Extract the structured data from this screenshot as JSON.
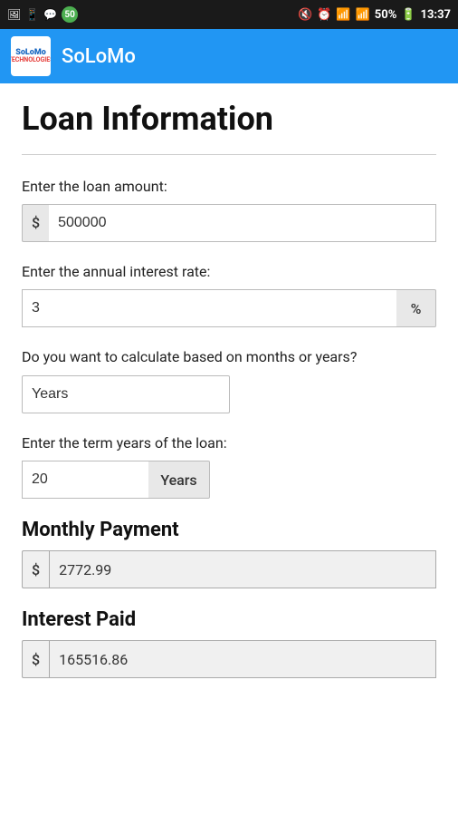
{
  "statusBar": {
    "time": "13:37",
    "battery": "50%",
    "notificationCount": "50"
  },
  "appBar": {
    "logo": "SoLoMo",
    "title": "SoLoMo"
  },
  "page": {
    "title": "Loan Information"
  },
  "form": {
    "loanAmountLabel": "Enter the loan amount:",
    "loanAmountPrefix": "$",
    "loanAmountValue": "500000",
    "interestRateLabel": "Enter the annual interest rate:",
    "interestRateValue": "3",
    "interestRateSuffix": "%",
    "calculationLabel": "Do you want to calculate based on months or years?",
    "calculationValue": "Years",
    "termLabel": "Enter the term years of the loan:",
    "termValue": "20",
    "termSuffix": "Years"
  },
  "results": {
    "monthlyPaymentTitle": "Monthly Payment",
    "monthlyPaymentPrefix": "$",
    "monthlyPaymentValue": "2772.99",
    "interestPaidTitle": "Interest Paid",
    "interestPaidPrefix": "$",
    "interestPaidValue": "165516.86"
  }
}
